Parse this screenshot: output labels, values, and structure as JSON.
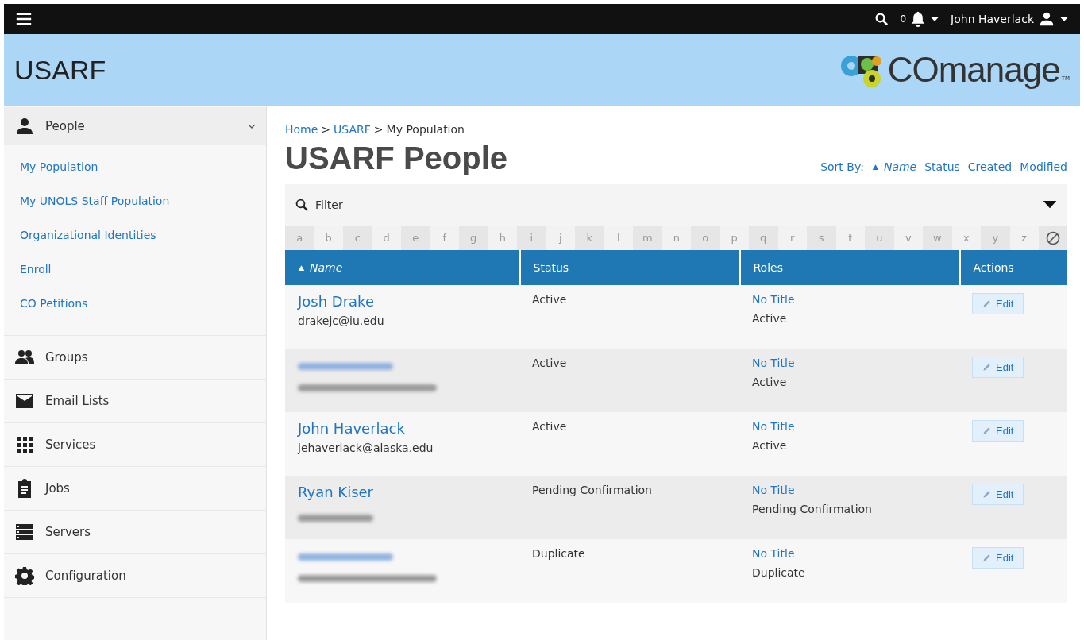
{
  "top_bar": {
    "notification_count": "0",
    "user_name": "John Haverlack"
  },
  "header": {
    "title": "USARF",
    "logo_text": "COmanage",
    "logo_mark": "TM"
  },
  "sidebar": {
    "sections": [
      {
        "label": "People",
        "kind": "person",
        "expanded": true,
        "children": [
          {
            "label": "My Population"
          },
          {
            "label": "My UNOLS Staff Population"
          },
          {
            "label": "Organizational Identities"
          },
          {
            "label": "Enroll"
          },
          {
            "label": "CO Petitions"
          }
        ]
      },
      {
        "label": "Groups",
        "kind": "group",
        "expanded": false
      },
      {
        "label": "Email Lists",
        "kind": "mail",
        "expanded": false
      },
      {
        "label": "Services",
        "kind": "grid",
        "expanded": false
      },
      {
        "label": "Jobs",
        "kind": "clipboard",
        "expanded": false
      },
      {
        "label": "Servers",
        "kind": "servers",
        "expanded": false
      },
      {
        "label": "Configuration",
        "kind": "gear",
        "expanded": false
      }
    ]
  },
  "breadcrumb": [
    {
      "label": "Home",
      "kind": "link"
    },
    {
      "label": ">",
      "kind": "sep"
    },
    {
      "label": "USARF",
      "kind": "link"
    },
    {
      "label": ">",
      "kind": "sep"
    },
    {
      "label": "My Population",
      "kind": "current"
    }
  ],
  "page_title": "USARF People",
  "sort_by": {
    "label": "Sort By:",
    "options": [
      {
        "label": "Name",
        "selected": true
      },
      {
        "label": "Status",
        "selected": false
      },
      {
        "label": "Created",
        "selected": false
      },
      {
        "label": "Modified",
        "selected": false
      }
    ]
  },
  "filter": {
    "label": "Filter"
  },
  "alphabet": [
    "a",
    "b",
    "c",
    "d",
    "e",
    "f",
    "g",
    "h",
    "i",
    "j",
    "k",
    "l",
    "m",
    "n",
    "o",
    "p",
    "q",
    "r",
    "s",
    "t",
    "u",
    "v",
    "w",
    "x",
    "y",
    "z"
  ],
  "table": {
    "columns": [
      {
        "label": "Name",
        "sorted": true
      },
      {
        "label": "Status",
        "sorted": false
      },
      {
        "label": "Roles",
        "sorted": false
      },
      {
        "label": "Actions",
        "sorted": false
      }
    ],
    "rows": [
      {
        "kind": "person",
        "name": "Josh Drake",
        "email": "drakejc@iu.edu",
        "status": "Active",
        "role_title": "No Title",
        "role_status": "Active",
        "action": "Edit"
      },
      {
        "kind": "redacted",
        "status": "Active",
        "role_title": "No Title",
        "role_status": "Active",
        "action": "Edit"
      },
      {
        "kind": "person",
        "name": "John Haverlack",
        "email": "jehaverlack@alaska.edu",
        "status": "Active",
        "role_title": "No Title",
        "role_status": "Active",
        "action": "Edit"
      },
      {
        "kind": "person_redacted_email",
        "name": "Ryan Kiser",
        "status": "Pending Confirmation",
        "role_title": "No Title",
        "role_status": "Pending Confirmation",
        "action": "Edit"
      },
      {
        "kind": "redacted",
        "status": "Duplicate",
        "role_title": "No Title",
        "role_status": "Duplicate",
        "action": "Edit"
      }
    ]
  }
}
